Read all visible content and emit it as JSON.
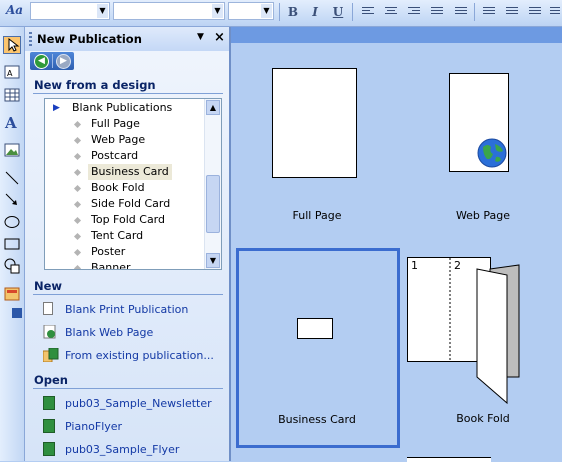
{
  "toolbar": {
    "style_icon": "Aa",
    "bold": "B",
    "italic": "I",
    "underline": "U"
  },
  "taskpane": {
    "title": "New Publication",
    "section_design": "New from a design",
    "designs": [
      "Blank Publications",
      "Full Page",
      "Web Page",
      "Postcard",
      "Business Card",
      "Book Fold",
      "Side Fold Card",
      "Top Fold Card",
      "Tent Card",
      "Poster",
      "Banner"
    ],
    "selected_design": "Business Card",
    "section_new": "New",
    "new_links": [
      "Blank Print Publication",
      "Blank Web Page",
      "From existing publication..."
    ],
    "section_open": "Open",
    "open_links": [
      "pub03_Sample_Newsletter",
      "PianoFlyer",
      "pub03_Sample_Flyer"
    ]
  },
  "gallery": {
    "items": [
      "Full Page",
      "Web Page",
      "Business Card",
      "Book Fold"
    ],
    "selected": "Business Card",
    "book_fold_pages": [
      "1",
      "2"
    ]
  },
  "colors": {
    "accent": "#3b6ccf",
    "gallery_bg": "#b3cdf2",
    "link": "#1339a5"
  }
}
